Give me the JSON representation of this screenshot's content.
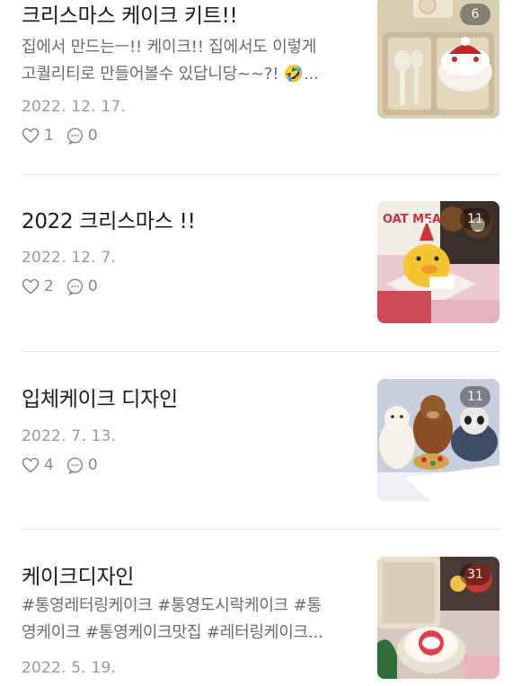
{
  "posts": [
    {
      "title": "크리스마스 케이크 키트!!",
      "summary": [
        "집에서 만드는ㅡ!! 케이크!! 집에서도 이렇게",
        "고퀄리티로 만들어볼수 있답니당~~?! 🤣..."
      ],
      "date": "2022. 12. 17.",
      "likes": "1",
      "comments": "0",
      "photo_count": "6"
    },
    {
      "title": "2022 크리스마스 !!",
      "summary": [],
      "date": "2022. 12. 7.",
      "likes": "2",
      "comments": "0",
      "photo_count": "11"
    },
    {
      "title": "입체케이크 디자인",
      "summary": [],
      "date": "2022. 7. 13.",
      "likes": "4",
      "comments": "0",
      "photo_count": "11"
    },
    {
      "title": "케이크디자인",
      "summary": [
        "#통영레터링케이크 #통영도시락케이크 #통",
        "영케이크 #통영케이크맛집 #레터링케이크..."
      ],
      "date": "2022. 5. 19.",
      "likes": "",
      "comments": "",
      "photo_count": "31"
    }
  ],
  "icons": {
    "like": "heart-outline-icon",
    "comment": "speech-bubble-icon"
  },
  "colors": {
    "text": "#1b1b1b",
    "muted": "#9a9a9a",
    "divider": "#e6e6e6"
  }
}
